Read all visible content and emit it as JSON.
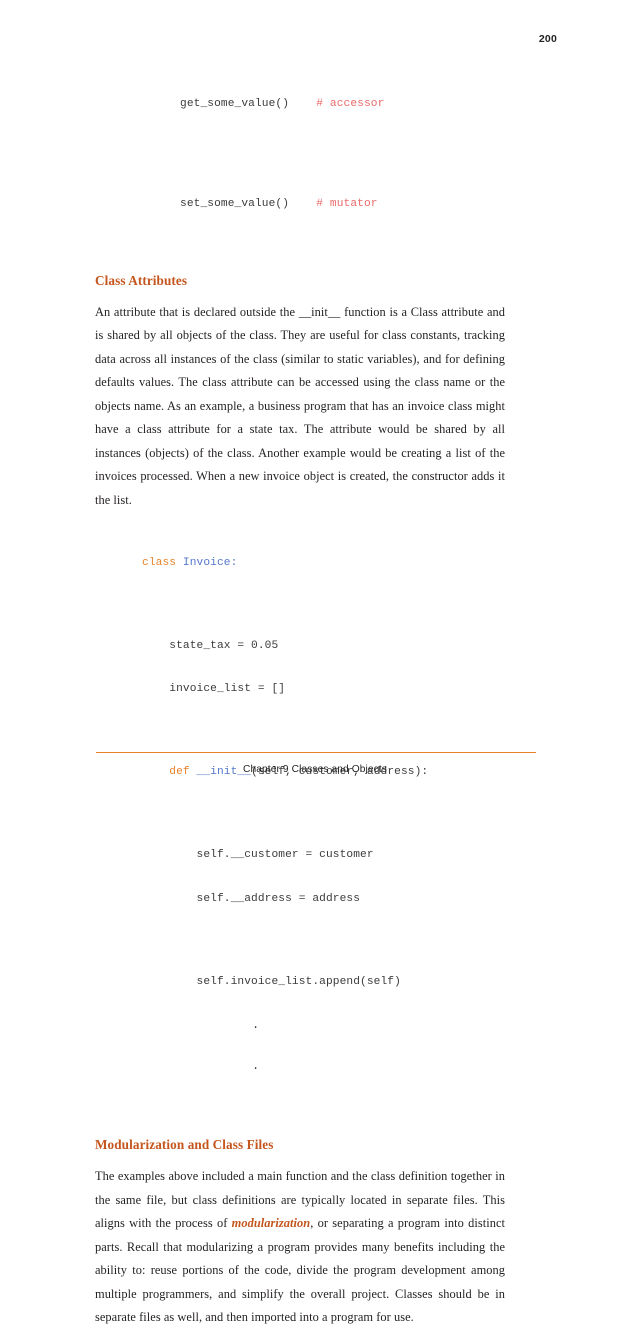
{
  "page": {
    "number": "200",
    "footer_text": "Chapter 9 Classes and Objects",
    "accent_color": "#c4551d",
    "rule_color": "#e8822a"
  },
  "code_top": {
    "line1_code": "get_some_value()",
    "line1_comment": "# accessor",
    "line2_code": "set_some_value()",
    "line2_comment": "# mutator"
  },
  "sections": [
    {
      "heading": "Class Attributes",
      "paragraph": "An attribute that is declared outside the __init__ function is a Class attribute and is shared by all objects of the class.  They are useful for class constants, tracking data across all instances of the class (similar to static variables), and for defining defaults values.  The class attribute can be accessed using the class name or the objects name.  As an example, a business program that has an invoice class might have a class attribute for a state tax.  The attribute would be shared by all instances (objects) of the class.  Another example would be creating a list of the invoices processed.  When a new invoice object is created, the constructor adds it the list."
    },
    {
      "heading": "Modularization and Class Files",
      "paragraph_part1": "The examples above included a main function and the class definition together in the same file, but class definitions are typically located in separate files.  This aligns with the process of ",
      "emphasis": "modularization",
      "paragraph_part2": ", or separating a program into distinct parts.  Recall that modularizing a program provides many benefits including the ability to: reuse portions of the code, divide the program development among multiple programmers, and simplify the overall project.  Classes should be in separate files as well, and then imported into a program for use."
    }
  ],
  "code_class": {
    "l1_kw": "class",
    "l1_name": " Invoice:",
    "l2": "    state_tax = 0.05",
    "l3": "    invoice_list = []",
    "l4_indent": "    ",
    "l4_kw": "def",
    "l4_name": " __init__",
    "l4_rest": "(self, customer, address):",
    "l5": "        self.__customer = customer",
    "l6": "        self.__address = address",
    "l7": "        self.invoice_list.append(self)",
    "dots": "."
  }
}
